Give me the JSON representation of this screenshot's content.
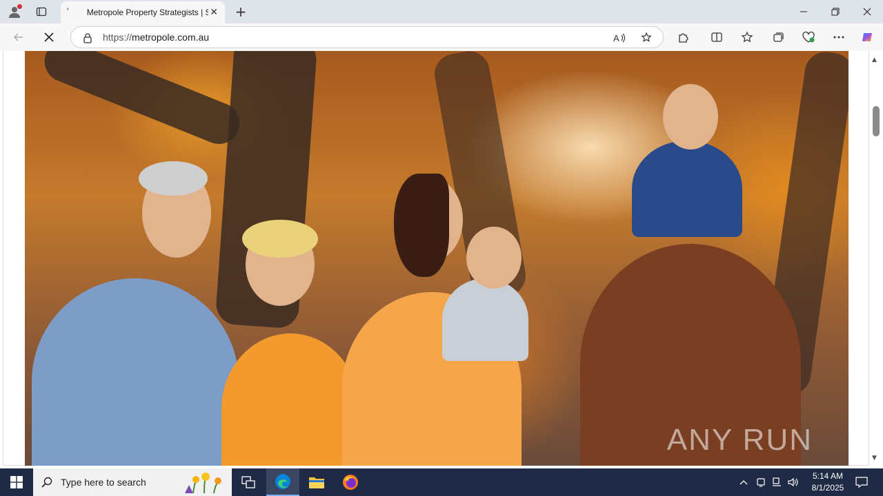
{
  "browser": {
    "tab_title": "Metropole Property Strategists | S",
    "url_prefix": "https://",
    "url_host": "metropole.com.au"
  },
  "page": {
    "watermark": "ANY RUN"
  },
  "taskbar": {
    "search_placeholder": "Type here to search",
    "time": "5:14 AM",
    "date": "8/1/2025"
  },
  "colors": {
    "taskbar_bg": "#1f2a44",
    "edge_accent": "#0a84d8"
  }
}
